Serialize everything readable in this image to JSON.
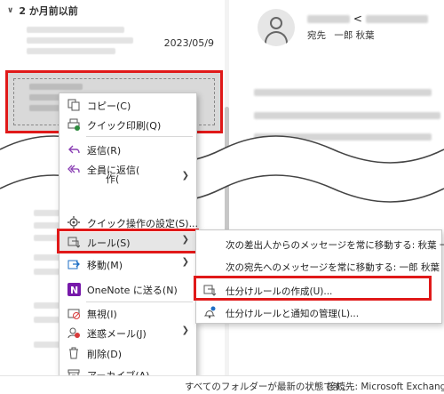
{
  "mail_list": {
    "group_label": "2 か月前以前",
    "first_item_date": "2023/05/9"
  },
  "reading_pane": {
    "sender_suffix": "<",
    "recipient_label": "宛先",
    "recipient_name": "一郎 秋葉"
  },
  "context_menu": {
    "items": [
      {
        "label": "コピー(C)",
        "icon": "copy-icon"
      },
      {
        "label": "クイック印刷(Q)",
        "icon": "print-icon"
      },
      {
        "label": "返信(R)",
        "icon": "reply-icon"
      },
      {
        "label": "全員に返信(",
        "icon": "reply-all-icon"
      },
      {
        "label": "作(",
        "icon": "quick-step-icon"
      },
      {
        "label": "クイック操作の設定(S)...",
        "icon": "settings-icon"
      },
      {
        "label": "ルール(S)",
        "icon": "rules-icon"
      },
      {
        "label": "移動(M)",
        "icon": "move-icon"
      },
      {
        "label": "OneNote に送る(N)",
        "icon": "onenote-icon"
      },
      {
        "label": "無視(I)",
        "icon": "ignore-icon"
      },
      {
        "label": "迷惑メール(J)",
        "icon": "junk-icon"
      },
      {
        "label": "削除(D)",
        "icon": "delete-icon"
      },
      {
        "label": "アーカイブ(A)...",
        "icon": "archive-icon"
      }
    ]
  },
  "rules_submenu": {
    "items": [
      {
        "label": "次の差出人からのメッセージを常に移動する: 秋葉 一郎"
      },
      {
        "label": "次の宛先へのメッセージを常に移動する: 一郎 秋葉"
      },
      {
        "label": "仕分けルールの作成(U)..."
      },
      {
        "label": "仕分けルールと通知の管理(L)..."
      }
    ]
  },
  "status_bar": {
    "folders_status": "すべてのフォルダーが最新の状態です。",
    "connection": "接続先: Microsoft Exchange"
  },
  "colors": {
    "highlight_red": "#e01919",
    "onenote_purple": "#7719aa",
    "accent_blue": "#1f6fc5"
  }
}
